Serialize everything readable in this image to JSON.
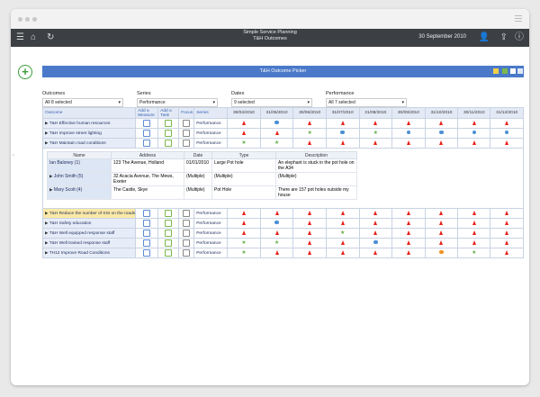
{
  "app": {
    "title_line1": "Simple Service Planning",
    "title_line2": "T&H Outcomes",
    "date": "30 September 2010"
  },
  "picker": {
    "title": "T&H Outcome Picker"
  },
  "filters": [
    {
      "label": "Outcomes",
      "value": "All 8 selected"
    },
    {
      "label": "Series",
      "value": "Performance"
    },
    {
      "label": "Dates",
      "value": "9 selected"
    },
    {
      "label": "Performance",
      "value": "All 7 selected"
    }
  ],
  "columns": {
    "outcome": "Outcome",
    "add_measure": "Add a Measure",
    "add_task": "Add a Task",
    "focus": "Focus",
    "series": "Series",
    "dates": [
      "30/04/2010",
      "31/05/2010",
      "30/06/2010",
      "31/07/2010",
      "31/08/2010",
      "30/09/2010",
      "31/10/2010",
      "30/11/2010",
      "31/12/2010"
    ]
  },
  "colors": {
    "red": "#e8211a",
    "blue": "#4a8fd6",
    "gray": "#9ea6b1",
    "orange": "#f39322",
    "green": "#6ab04c"
  },
  "rows_top": [
    {
      "name": "T&H Effective human resources",
      "series": "Performance",
      "cells": [
        "t",
        "cb",
        "t",
        "t",
        "t",
        "t",
        "t",
        "t",
        "t"
      ]
    },
    {
      "name": "T&H Improve street lighting",
      "series": "Performance",
      "cells": [
        "t",
        "t",
        "s",
        "cb",
        "s",
        "cb",
        "cb",
        "cb",
        "cb"
      ]
    },
    {
      "name": "T&H Maintain road conditions",
      "series": "Performance",
      "cells": [
        "s",
        "s",
        "t",
        "t",
        "t",
        "t",
        "t",
        "t",
        "t"
      ]
    }
  ],
  "sub": {
    "headers": [
      "Name",
      "Address",
      "Date",
      "Type",
      "Description"
    ],
    "rows": [
      {
        "name": "Ian Baloney (1)",
        "address": "123 The Avenue, Holland",
        "date": "01/01/2010",
        "type": "Large Pot hole",
        "desc": "An elephant is stuck in the pot hole on the A34"
      },
      {
        "name": "John Smith (5)",
        "address": "32 Acacia Avenue, The Mews, Exeter",
        "date": "(Multiple)",
        "type": "(Multiple)",
        "desc": "(Multiple)"
      },
      {
        "name": "Mary Scott (4)",
        "address": "The Castle, Skye",
        "date": "(Multiple)",
        "type": "Pot Hole",
        "desc": "There are 157 pot holes outside my house"
      }
    ]
  },
  "rows_bottom": [
    {
      "name": "T&H Reduce the number of KSI on the roads",
      "series": "Performance",
      "highlight": true,
      "cells": [
        "t",
        "t",
        "t",
        "t",
        "t",
        "t",
        "t",
        "t",
        "t"
      ]
    },
    {
      "name": "T&H Safety education",
      "series": "Performance",
      "cells": [
        "t",
        "cb",
        "t",
        "t",
        "t",
        "t",
        "t",
        "t",
        "t"
      ]
    },
    {
      "name": "T&H Well equipped response staff",
      "series": "Performance",
      "cells": [
        "t",
        "t",
        "t",
        "s",
        "t",
        "t",
        "t",
        "t",
        "t"
      ]
    },
    {
      "name": "T&H Well trained response staff",
      "series": "Performance",
      "cells": [
        "s",
        "s",
        "t",
        "t",
        "cb",
        "t",
        "t",
        "t",
        "t"
      ]
    },
    {
      "name": "TH12 Improve Road Conditions",
      "series": "Performance",
      "cells": [
        "s",
        "t",
        "t",
        "t",
        "t",
        "t",
        "co",
        "s",
        "t"
      ]
    }
  ]
}
